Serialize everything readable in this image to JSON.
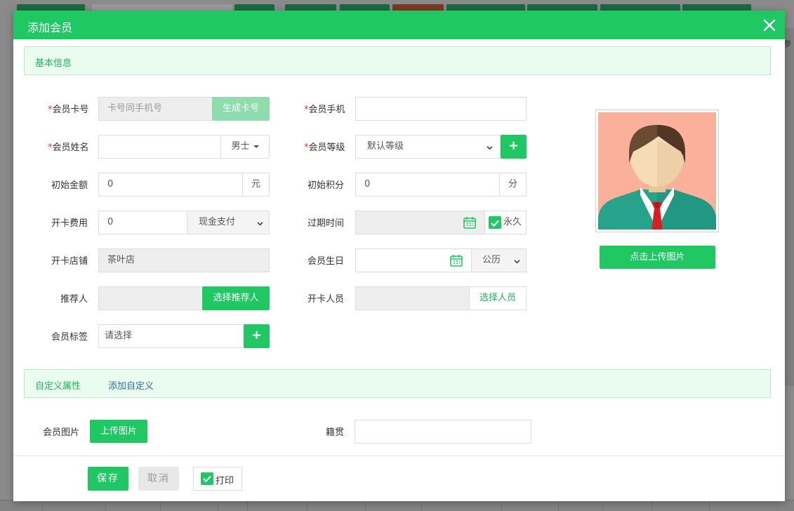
{
  "colors": {
    "primary": "#20c863",
    "required": "#e53935",
    "section_bg": "#eafbef"
  },
  "modal": {
    "title": "添加会员",
    "close_icon": "close-icon"
  },
  "section_basic": {
    "tab": "基本信息"
  },
  "form": {
    "card_no": {
      "label": "会员卡号",
      "placeholder": "卡号同手机号",
      "button": "生成卡号"
    },
    "phone": {
      "label": "会员手机",
      "value": ""
    },
    "name": {
      "label": "会员姓名",
      "value": "",
      "gender": "男士"
    },
    "level": {
      "label": "会员等级",
      "value": "默认等级"
    },
    "init_amount": {
      "label": "初始金额",
      "value": "0",
      "unit": "元"
    },
    "init_points": {
      "label": "初始积分",
      "value": "0",
      "unit": "分"
    },
    "card_fee": {
      "label": "开卡费用",
      "value": "0",
      "payment": "现金支付"
    },
    "expire": {
      "label": "过期时间",
      "value": "",
      "permanent_label": "永久",
      "permanent_checked": true
    },
    "store": {
      "label": "开卡店铺",
      "value": "茶叶店"
    },
    "birthday": {
      "label": "会员生日",
      "value": "",
      "calendar": "公历"
    },
    "referrer": {
      "label": "推荐人",
      "value": "",
      "button": "选择推荐人"
    },
    "staff": {
      "label": "开卡人员",
      "value": "",
      "button": "选择人员"
    },
    "tags": {
      "label": "会员标签",
      "placeholder": "请选择"
    }
  },
  "avatar": {
    "upload_button": "点击上传图片"
  },
  "section_custom": {
    "tab1": "自定义属性",
    "tab2": "添加自定义"
  },
  "custom": {
    "photo": {
      "label": "会员图片",
      "button": "上传图片"
    },
    "origin": {
      "label": "籍贯",
      "value": ""
    }
  },
  "footer": {
    "save": "保存",
    "cancel": "取消",
    "print_label": "打印",
    "print_checked": true
  },
  "background": {
    "side_label": "参"
  }
}
